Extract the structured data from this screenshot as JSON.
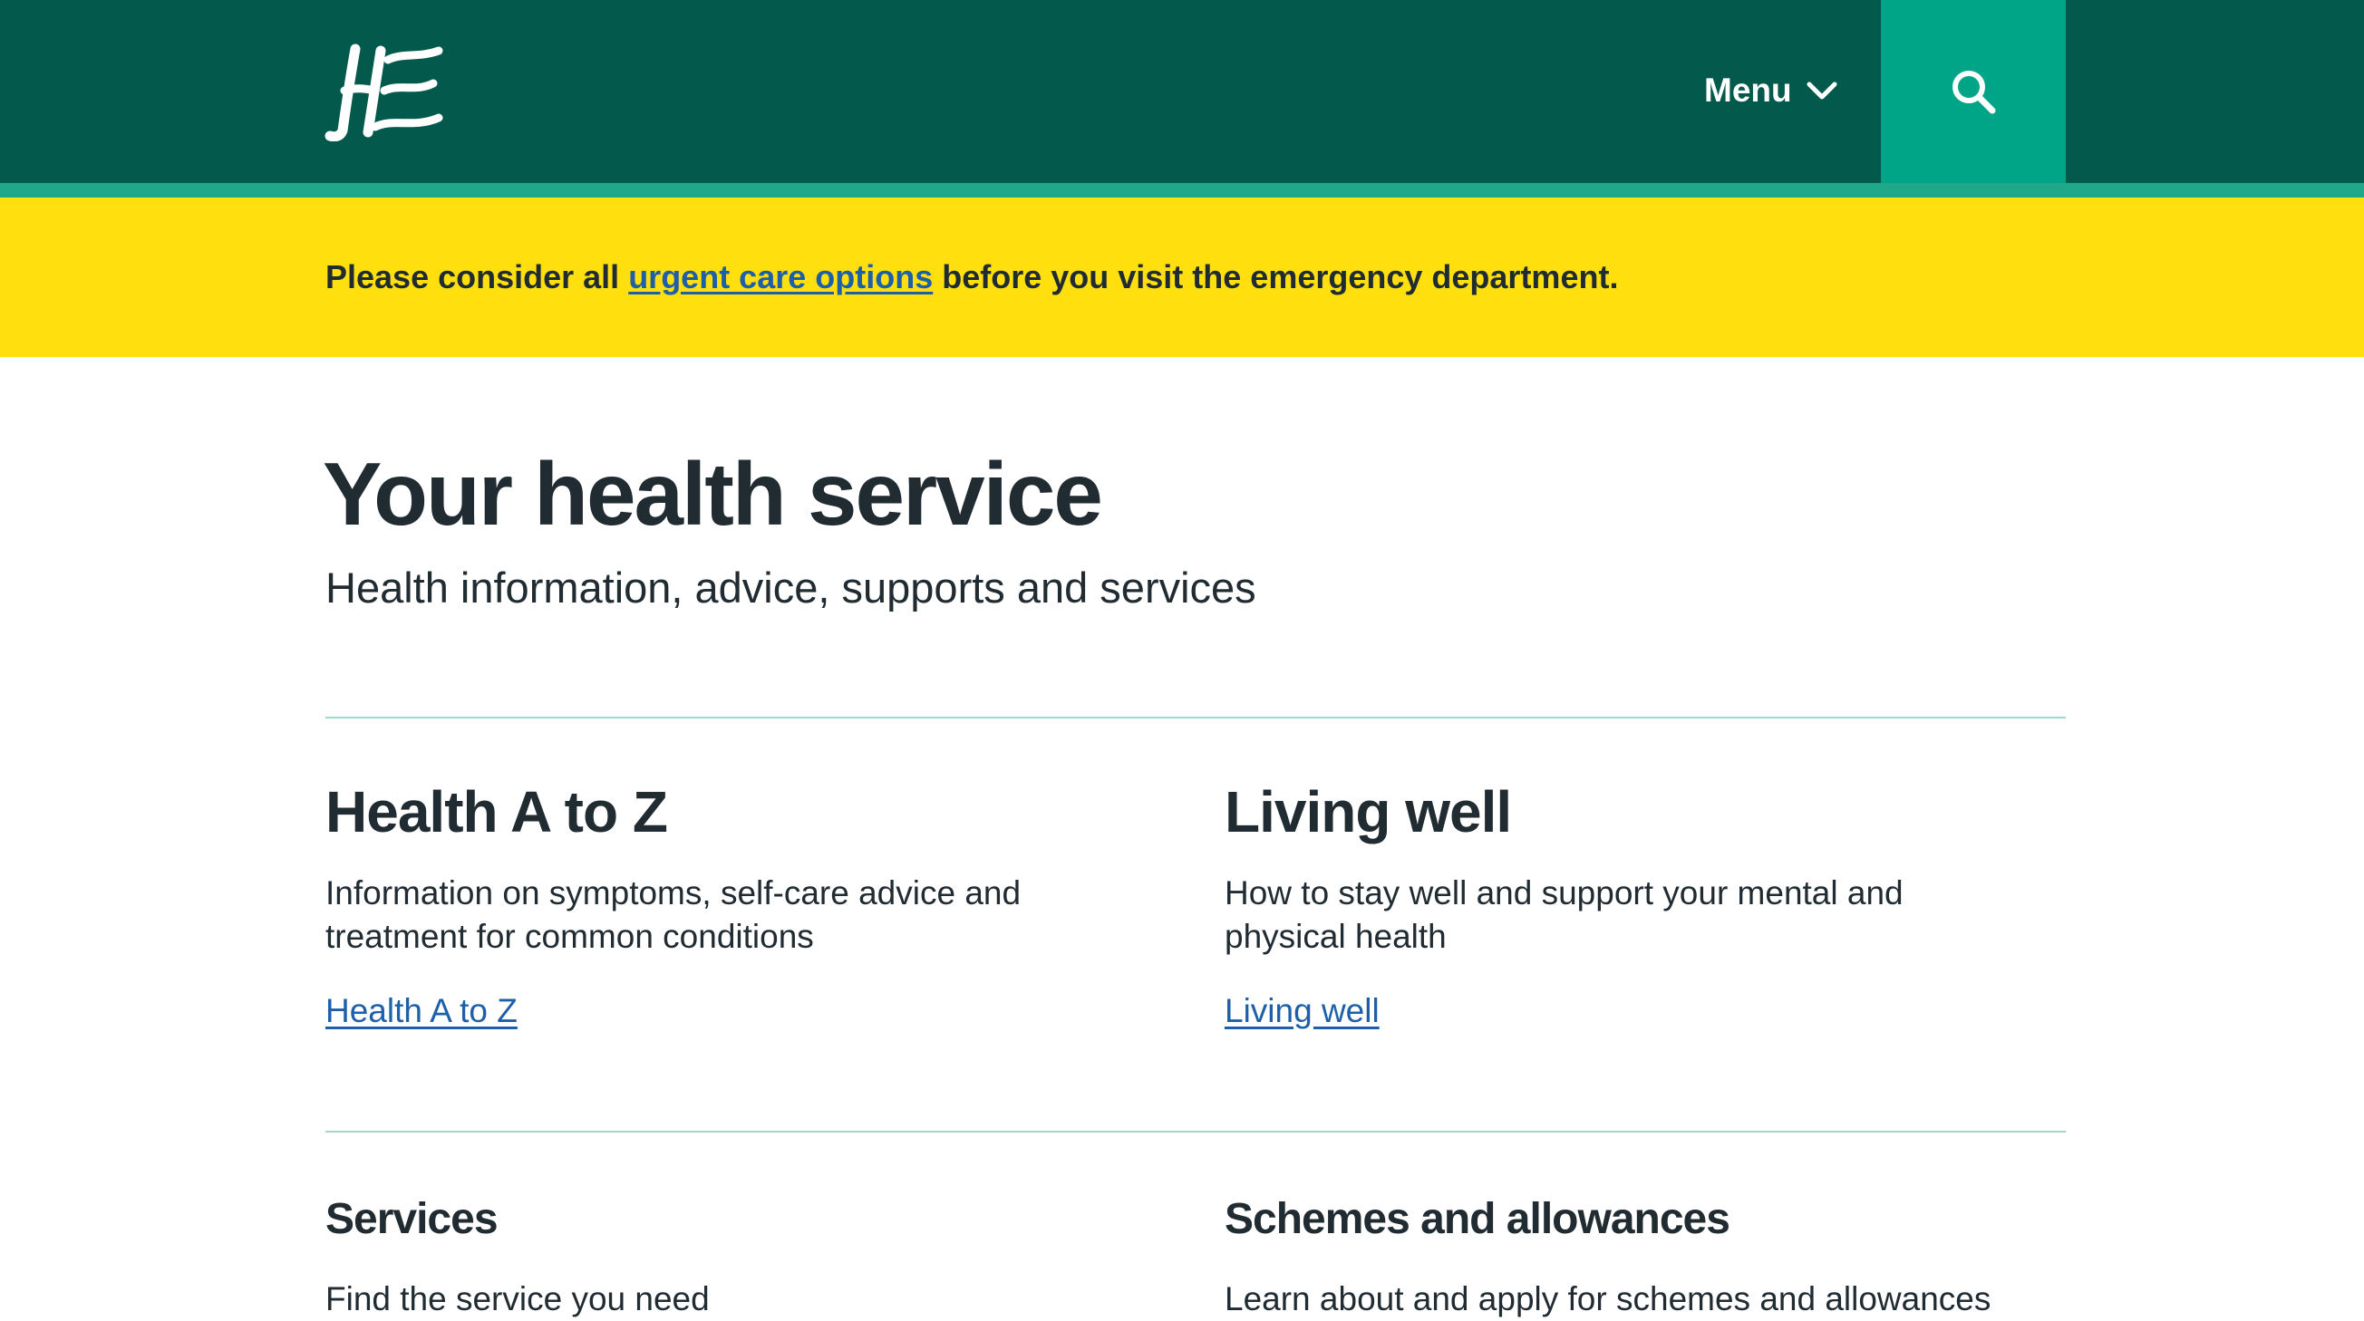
{
  "header": {
    "logo_alt": "HSE",
    "menu_label": "Menu",
    "search_label": "Search",
    "colors": {
      "background": "#02594c",
      "stripe": "#1fa98a",
      "search_button": "#00a487"
    }
  },
  "alert": {
    "text_before": "Please consider all ",
    "link_text": "urgent care options",
    "text_after": " before you visit the emergency department.",
    "background": "#ffdf0e"
  },
  "hero": {
    "title": "Your health service",
    "subtitle": "Health information, advice, supports and services"
  },
  "cards": [
    {
      "title": "Health A to Z",
      "description": "Information on symptoms, self-care advice and treatment for common conditions",
      "link": "Health A to Z"
    },
    {
      "title": "Living well",
      "description": "How to stay well and support your mental and physical health",
      "link": "Living well"
    },
    {
      "title": "Services",
      "description": "Find the service you need"
    },
    {
      "title": "Schemes and allowances",
      "description": "Learn about and apply for schemes and allowances"
    }
  ],
  "colors": {
    "text": "#212b32",
    "link": "#1d5fa8",
    "divider": "#9fd7cd"
  }
}
